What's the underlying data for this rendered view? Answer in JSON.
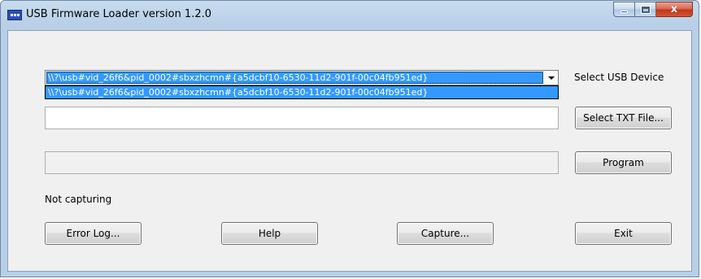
{
  "window": {
    "title": "USB Firmware Loader version 1.2.0",
    "close_glyph": "x"
  },
  "device": {
    "selected": "\\\\?\\usb#vid_26f6&pid_0002#sbxzhcmn#{a5dcbf10-6530-11d2-901f-00c04fb951ed}",
    "options": [
      "\\\\?\\usb#vid_26f6&pid_0002#sbxzhcmn#{a5dcbf10-6530-11d2-901f-00c04fb951ed}"
    ],
    "label": "Select USB Device"
  },
  "file": {
    "path": "",
    "button_label": "Select TXT File..."
  },
  "progress": {
    "value": "",
    "button_label": "Program"
  },
  "status": {
    "text": "Not capturing"
  },
  "buttons": {
    "error_log": "Error Log...",
    "help": "Help",
    "capture": "Capture...",
    "exit": "Exit"
  },
  "colors": {
    "selection": "#3399ff",
    "window_frame": "#b8cfe7",
    "client_bg": "#f0f0f0",
    "close_button": "#c2361d"
  },
  "icons": {
    "app": "app-icon",
    "minimize": "minimize-icon",
    "maximize": "maximize-icon",
    "close": "close-icon",
    "dropdown": "chevron-down-icon"
  }
}
